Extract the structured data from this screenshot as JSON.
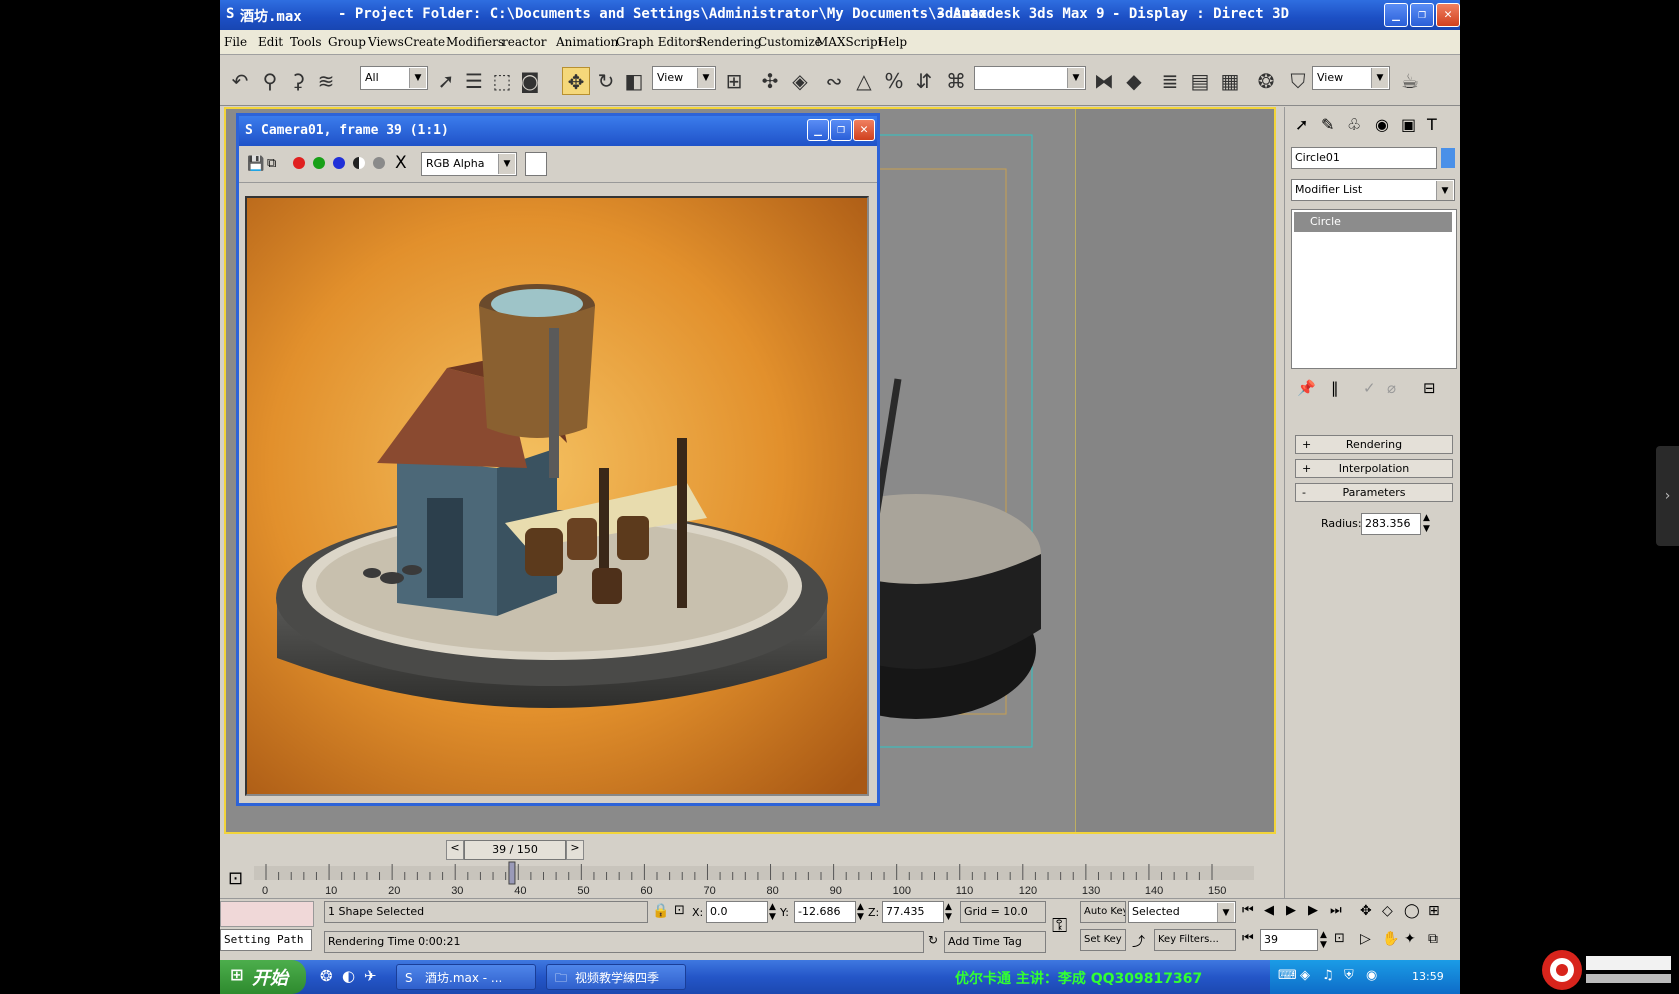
{
  "window": {
    "app_icon": "3ds-max-icon",
    "title_file": "酒坊.max",
    "title_project": "- Project Folder: C:\\Documents and Settings\\Administrator\\My Documents\\3dsmax",
    "title_app": "- Autodesk 3ds Max 9",
    "title_display": "- Display : Direct 3D",
    "min_label": "_",
    "max_label": "❐",
    "close_label": "✕"
  },
  "menu": [
    "File",
    "Edit",
    "Tools",
    "Group",
    "Views",
    "Create",
    "Modifiers",
    "reactor",
    "Animation",
    "Graph Editors",
    "Rendering",
    "Customize",
    "MAXScript",
    "Help"
  ],
  "toolbar": {
    "selection_filter": "All",
    "ref_coord": "View",
    "named_selection": "",
    "render_view": "View"
  },
  "render_window": {
    "title": "Camera01, frame 39 (1:1)",
    "channel": "RGB Alpha",
    "clear_label": "X"
  },
  "command_panel": {
    "object_name": "Circle01",
    "modifier_list": "Modifier List",
    "stack_item": "Circle",
    "rollouts": [
      {
        "sign": "+",
        "label": "Rendering"
      },
      {
        "sign": "+",
        "label": "Interpolation"
      },
      {
        "sign": "-",
        "label": "Parameters"
      }
    ],
    "radius_label": "Radius:",
    "radius_value": "283.356"
  },
  "timeline": {
    "frame_label": "39 / 150",
    "current_frame": 39,
    "total_frames": 150,
    "ticks": [
      "0",
      "10",
      "20",
      "30",
      "40",
      "50",
      "60",
      "70",
      "80",
      "90",
      "100",
      "110",
      "120",
      "130",
      "140",
      "150"
    ]
  },
  "status": {
    "selection": "1 Shape Selected",
    "prompt": "Rendering Time  0:00:21",
    "script_label": "Setting Path",
    "x_label": "X:",
    "x_value": "0.0",
    "y_label": "Y:",
    "y_value": "-12.686",
    "z_label": "Z:",
    "z_value": "77.435",
    "grid": "Grid = 10.0",
    "add_time_tag": "Add Time Tag",
    "auto_key": "Auto Key",
    "set_key": "Set Key",
    "key_mode": "Selected",
    "key_filters": "Key Filters...",
    "frame_field": "39"
  },
  "taskbar": {
    "start": "开始",
    "tasks": [
      {
        "label": "酒坊.max - ..."
      },
      {
        "label": "视频教学練四季"
      }
    ],
    "tray_text": "优尔卡通  主讲：李成  QQ309817367",
    "clock": "13:59"
  },
  "colors": {
    "title_blue": "#1c4fc4",
    "viewport_border": "#f2d43a",
    "render_bg": "#e0902a"
  }
}
